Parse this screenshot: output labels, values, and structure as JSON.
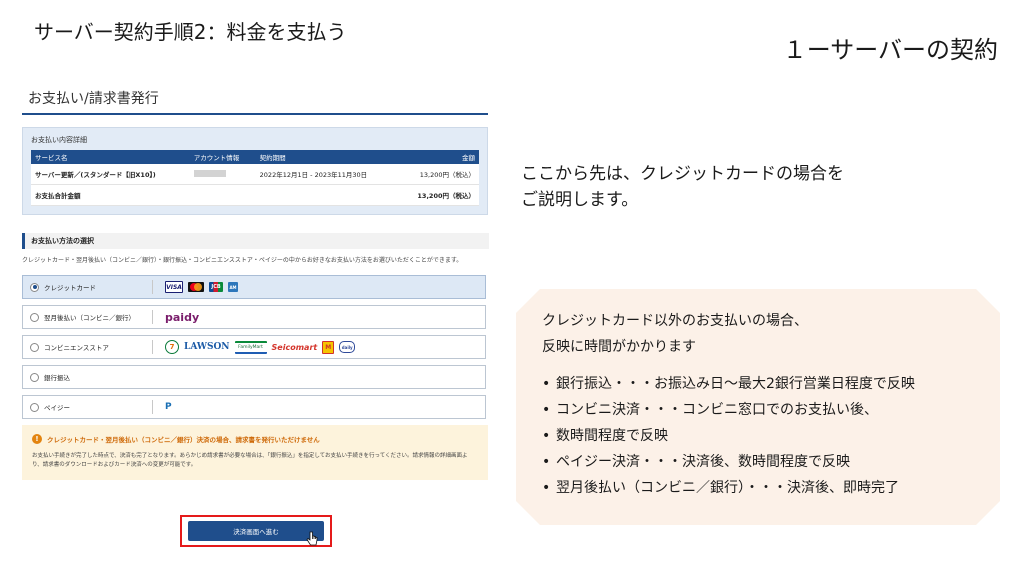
{
  "slide": {
    "title": "サーバー契約手順2：料金を支払う",
    "subtitle": "１ーサーバーの契約"
  },
  "screenshot": {
    "page_title": "お支払い/請求書発行",
    "details": {
      "label": "お支払い内容詳細",
      "headers": [
        "サービス名",
        "アカウント情報",
        "契約期間",
        "金額"
      ],
      "row": [
        "サーバー更新／(スタンダード【旧X10】)",
        "",
        "2022年12月1日 - 2023年11月30日",
        "13,200円（税込）"
      ],
      "total_label": "お支払合計金額",
      "total_value": "13,200円（税込）"
    },
    "method_heading": "お支払い方法の選択",
    "method_desc": "クレジットカード・翌月後払い（コンビニ／銀行）・銀行振込・コンビニエンスストア・ペイジーの中からお好きなお支払い方法をお選びいただくことができます。",
    "options": [
      {
        "label": "クレジットカード",
        "selected": true
      },
      {
        "label": "翌月後払い（コンビニ／銀行）",
        "selected": false
      },
      {
        "label": "コンビニエンスストア",
        "selected": false
      },
      {
        "label": "銀行振込",
        "selected": false
      },
      {
        "label": "ペイジー",
        "selected": false
      }
    ],
    "logos": {
      "visa": "VISA",
      "jcb": "JCB",
      "amex": "AM",
      "paidy": "paidy",
      "seven": "7",
      "lawson": "LAWSON",
      "familymart": "FamilyMart",
      "seicomart": "Seicomart",
      "ministop": "M",
      "dailyyamazaki": "daily",
      "payeasy": "P"
    },
    "warning": {
      "title": "クレジットカード・翌月後払い（コンビニ／銀行）決済の場合、請求書を発行いただけません",
      "body": "お支払い手続きが完了した時点で、決済も完了となります。あらかじめ請求書が必要な場合は、「銀行振込」を指定してお支払い手続きを行ってください。請求情報の詳細画面より、請求書のダウンロードおよびカード決済への変更が可能です。"
    },
    "proceed_button": "決済画面へ進む"
  },
  "explanation": {
    "line1": "ここから先は、クレジットカードの場合を",
    "line2": "ご説明します。"
  },
  "note": {
    "head1": "クレジットカード以外のお支払いの場合、",
    "head2": "反映に時間がかかります",
    "items": [
      "銀行振込・・・お振込み日〜最大2銀行営業日程度で反映",
      "コンビニ決済・・・コンビニ窓口でのお支払い後、",
      "数時間程度で反映",
      "ペイジー決済・・・決済後、数時間程度で反映",
      "翌月後払い（コンビニ／銀行）・・・決済後、即時完了"
    ]
  },
  "colors": {
    "brand_blue": "#1f4e8c",
    "highlight_red": "#e51a1a",
    "warning_orange": "#e3840f",
    "note_bg": "#fcf1e8"
  }
}
